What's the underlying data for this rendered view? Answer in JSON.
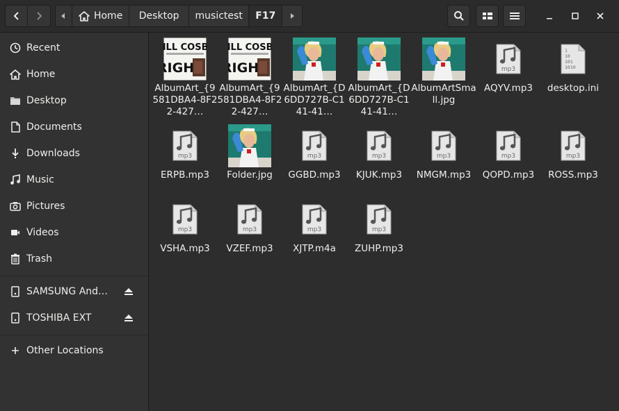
{
  "header": {
    "breadcrumbs": [
      "Home",
      "Desktop",
      "musictest",
      "F17"
    ]
  },
  "sidebar": {
    "places": [
      {
        "label": "Recent",
        "icon": "clock-icon"
      },
      {
        "label": "Home",
        "icon": "home-icon"
      },
      {
        "label": "Desktop",
        "icon": "folder-icon"
      },
      {
        "label": "Documents",
        "icon": "document-icon"
      },
      {
        "label": "Downloads",
        "icon": "download-icon"
      },
      {
        "label": "Music",
        "icon": "music-icon"
      },
      {
        "label": "Pictures",
        "icon": "camera-icon"
      },
      {
        "label": "Videos",
        "icon": "video-icon"
      },
      {
        "label": "Trash",
        "icon": "trash-icon"
      }
    ],
    "devices": [
      {
        "label": "SAMSUNG And…",
        "icon": "drive-icon"
      },
      {
        "label": "TOSHIBA EXT",
        "icon": "drive-icon"
      }
    ],
    "other": {
      "label": "Other Locations",
      "icon": "plus-icon"
    }
  },
  "files": [
    {
      "name": "AlbumArt_{9581DBA4-8F22-427…",
      "type": "image-cosby"
    },
    {
      "name": "AlbumArt_{9581DBA4-8F22-427…",
      "type": "image-cosby"
    },
    {
      "name": "AlbumArt_{D6DD727B-C141-41…",
      "type": "image-nurse"
    },
    {
      "name": "AlbumArt_{D6DD727B-C141-41…",
      "type": "image-nurse"
    },
    {
      "name": "AlbumArtSmall.jpg",
      "type": "image-nurse"
    },
    {
      "name": "AQYV.mp3",
      "type": "mp3"
    },
    {
      "name": "desktop.ini",
      "type": "ini"
    },
    {
      "name": "ERPB.mp3",
      "type": "mp3"
    },
    {
      "name": "Folder.jpg",
      "type": "image-nurse"
    },
    {
      "name": "GGBD.mp3",
      "type": "mp3"
    },
    {
      "name": "KJUK.mp3",
      "type": "mp3"
    },
    {
      "name": "NMGM.mp3",
      "type": "mp3"
    },
    {
      "name": "QOPD.mp3",
      "type": "mp3"
    },
    {
      "name": "ROSS.mp3",
      "type": "mp3"
    },
    {
      "name": "VSHA.mp3",
      "type": "mp3"
    },
    {
      "name": "VZEF.mp3",
      "type": "mp3"
    },
    {
      "name": "XJTP.m4a",
      "type": "mp3"
    },
    {
      "name": "ZUHP.mp3",
      "type": "mp3"
    }
  ],
  "labels": {
    "mp3_badge": "mp3",
    "ini_lines": [
      "1",
      "10",
      "101",
      "1010"
    ],
    "cosby_line1": "BILL COSBY",
    "cosby_line2": "RIGHT"
  },
  "colors": {
    "background": "#2d2d2d",
    "sidebar": "#323232",
    "text": "#eeeeec"
  }
}
